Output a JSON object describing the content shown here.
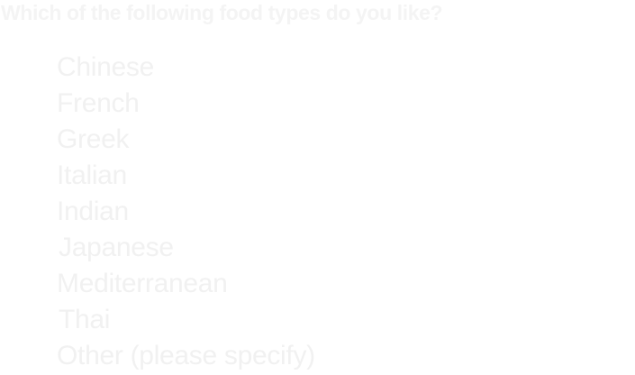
{
  "question": {
    "text": "Which of the following food types do you like?"
  },
  "options": [
    {
      "label": "Chinese"
    },
    {
      "label": "French"
    },
    {
      "label": "Greek"
    },
    {
      "label": "Italian"
    },
    {
      "label": "Indian"
    },
    {
      "label": "Japanese"
    },
    {
      "label": "Mediterranean"
    },
    {
      "label": "Thai"
    },
    {
      "label": "Other (please specify)"
    }
  ],
  "colors": {
    "background": "#ffffff",
    "question_text": "#f4f4f4",
    "option_text": "#f1f1f1"
  }
}
